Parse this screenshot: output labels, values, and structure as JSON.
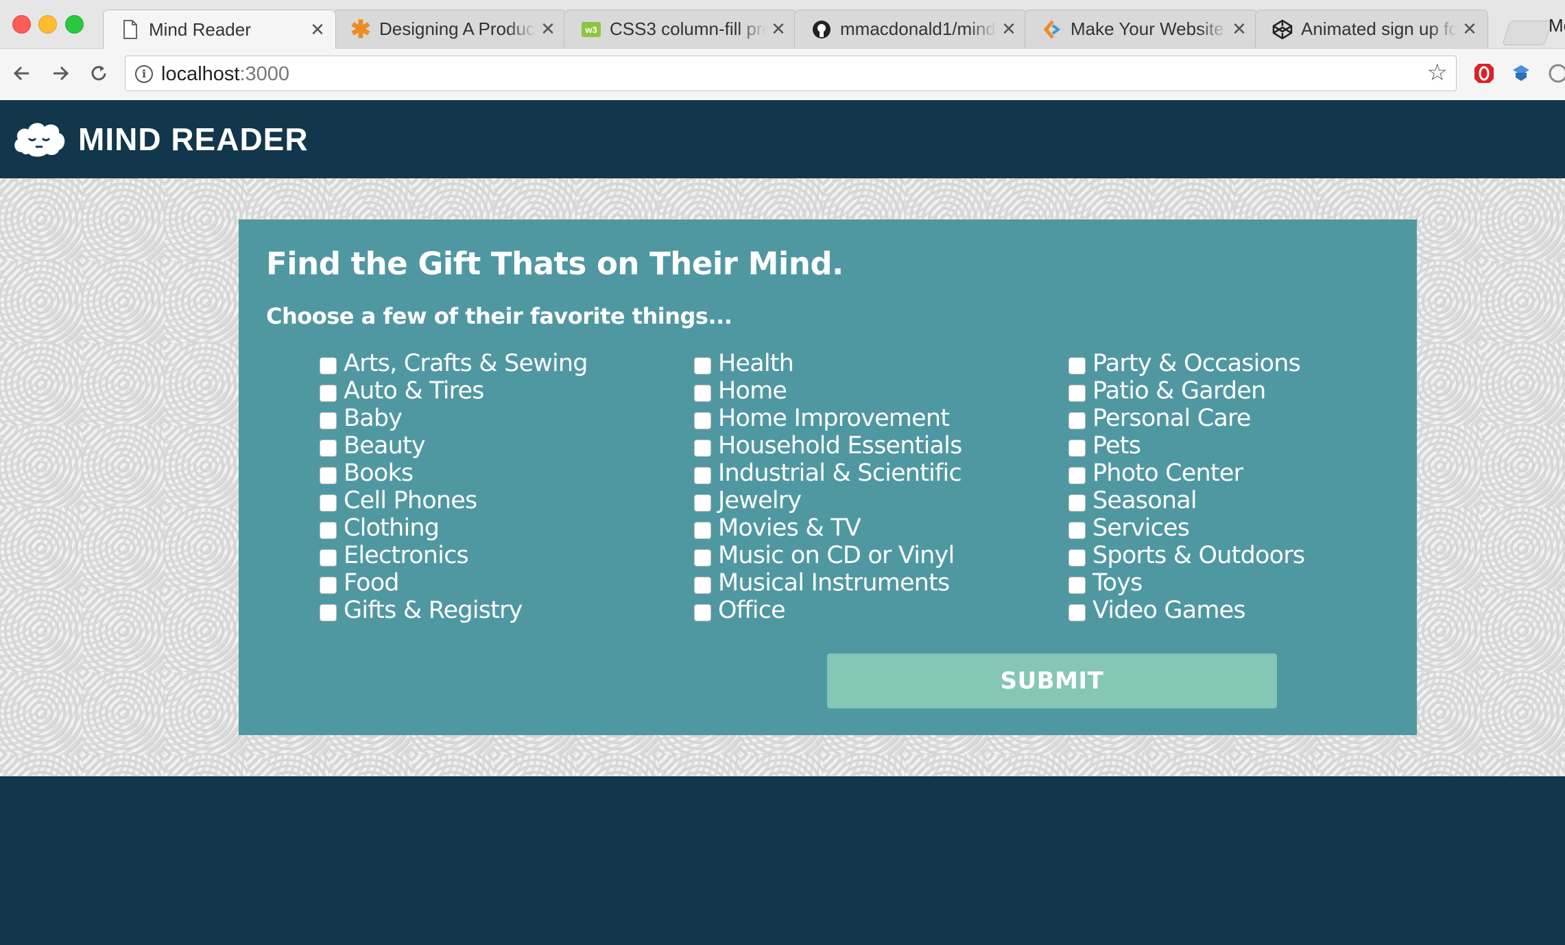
{
  "browser": {
    "tabs": [
      {
        "title": "Mind Reader",
        "icon": "page-icon",
        "active": true
      },
      {
        "title": "Designing A Product",
        "icon": "asterisk-icon"
      },
      {
        "title": "CSS3 column-fill property",
        "icon": "css3-icon"
      },
      {
        "title": "mmacdonald1/mind",
        "icon": "github-icon"
      },
      {
        "title": "Make Your Website",
        "icon": "chevron-logo-icon"
      },
      {
        "title": "Animated sign up fo",
        "icon": "codepen-icon"
      }
    ],
    "profile_label": "Me",
    "address": {
      "host": "localhost",
      "port": ":3000"
    }
  },
  "app": {
    "brand": "MIND READER",
    "heading": "Find the Gift Thats on Their Mind.",
    "subheading": "Choose a few of their favorite things...",
    "columns": [
      [
        "Arts, Crafts & Sewing",
        "Auto & Tires",
        "Baby",
        "Beauty",
        "Books",
        "Cell Phones",
        "Clothing",
        "Electronics",
        "Food",
        "Gifts & Registry"
      ],
      [
        "Health",
        "Home",
        "Home Improvement",
        "Household Essentials",
        "Industrial & Scientific",
        "Jewelry",
        "Movies & TV",
        "Music on CD or Vinyl",
        "Musical Instruments",
        "Office"
      ],
      [
        "Party & Occasions",
        "Patio & Garden",
        "Personal Care",
        "Pets",
        "Photo Center",
        "Seasonal",
        "Services",
        "Sports & Outdoors",
        "Toys",
        "Video Games"
      ]
    ],
    "submit_label": "SUBMIT"
  },
  "colors": {
    "header": "#12364b",
    "card": "#5098a1",
    "submit": "#86c6b4"
  }
}
